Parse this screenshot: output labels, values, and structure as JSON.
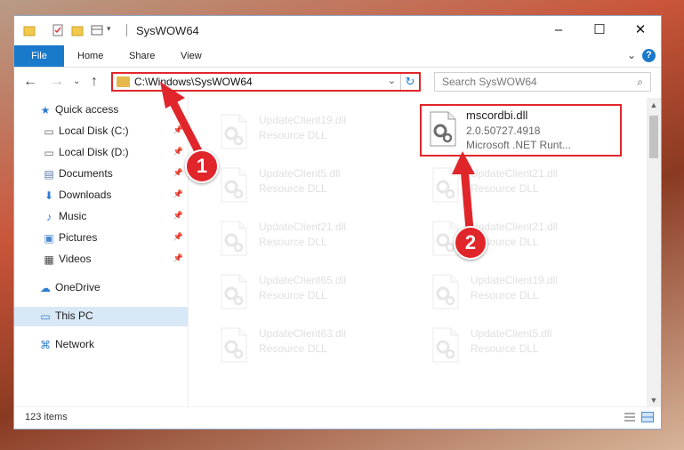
{
  "window": {
    "title": "SysWOW64",
    "controls": {
      "minimize": "–",
      "maximize": "☐",
      "close": "✕"
    }
  },
  "ribbon": {
    "tabs": [
      "File",
      "Home",
      "Share",
      "View"
    ]
  },
  "navigation": {
    "address": "C:\\Windows\\SysWOW64",
    "search_placeholder": "Search SysWOW64"
  },
  "sidebar": {
    "items": [
      {
        "label": "Quick access",
        "icon": "star-icon",
        "pinned": false
      },
      {
        "label": "Local Disk (C:)",
        "icon": "drive-icon",
        "pinned": true
      },
      {
        "label": "Local Disk (D:)",
        "icon": "drive-icon",
        "pinned": true
      },
      {
        "label": "Documents",
        "icon": "documents-icon",
        "pinned": true
      },
      {
        "label": "Downloads",
        "icon": "downloads-icon",
        "pinned": true
      },
      {
        "label": "Music",
        "icon": "music-icon",
        "pinned": true
      },
      {
        "label": "Pictures",
        "icon": "pictures-icon",
        "pinned": true
      },
      {
        "label": "Videos",
        "icon": "videos-icon",
        "pinned": true
      },
      {
        "label": "OneDrive",
        "icon": "onedrive-icon",
        "pinned": false
      },
      {
        "label": "This PC",
        "icon": "pc-icon",
        "pinned": false,
        "selected": true
      },
      {
        "label": "Network",
        "icon": "network-icon",
        "pinned": false
      }
    ]
  },
  "files": {
    "left_column": [
      {
        "name": "UpdateClient19.dll",
        "type": "Resource DLL"
      },
      {
        "name": "UpdateClient5.dll",
        "type": "Resource DLL"
      },
      {
        "name": "UpdateClient21.dll",
        "type": "Resource DLL"
      },
      {
        "name": "UpdateClient65.dll",
        "type": "Resource DLL"
      },
      {
        "name": "UpdateClient63.dll",
        "type": "Resource DLL"
      }
    ],
    "right_column": [
      {
        "name": "UpdateClient21.dll",
        "type": "Resource DLL"
      },
      {
        "name": "UpdateClient21.dll",
        "type": "Resource DLL"
      },
      {
        "name": "UpdateClient19.dll",
        "type": "Resource DLL"
      },
      {
        "name": "UpdateClient5.dll",
        "type": "Resource DLL"
      }
    ],
    "highlighted": {
      "name": "mscordbi.dll",
      "version": "2.0.50727.4918",
      "description": "Microsoft .NET Runt..."
    }
  },
  "status": {
    "item_count": "123 items"
  },
  "callouts": {
    "one": "1",
    "two": "2"
  },
  "colors": {
    "accent": "#1979ca",
    "highlight": "#e0262b"
  }
}
